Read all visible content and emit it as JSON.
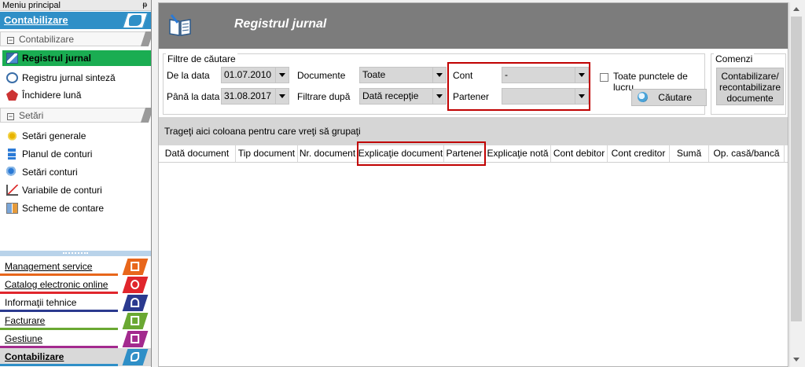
{
  "sidebar": {
    "title": "Meniu principal",
    "pin": "ᵽ",
    "section_title": "Contabilizare",
    "group1": {
      "label": "Contabilizare",
      "toggle": "−"
    },
    "group1_items": [
      {
        "label": "Registrul jurnal",
        "icon": "journal-book-icon"
      },
      {
        "label": "Registru jurnal sinteză",
        "icon": "refresh-icon"
      },
      {
        "label": "Închidere lună",
        "icon": "gem-icon"
      }
    ],
    "group2": {
      "label": "Setări",
      "toggle": "−"
    },
    "group2_items": [
      {
        "label": "Setări generale",
        "icon": "gear-icon"
      },
      {
        "label": "Planul de conturi",
        "icon": "list-icon"
      },
      {
        "label": "Setări conturi",
        "icon": "settings-icon"
      },
      {
        "label": "Variabile de conturi",
        "icon": "chart-icon"
      },
      {
        "label": "Scheme de contare",
        "icon": "scheme-icon"
      }
    ],
    "modules": [
      {
        "label": "Management service",
        "color": "#e8661b"
      },
      {
        "label": "Catalog electronic online",
        "color": "#e0262c"
      },
      {
        "label": "Informaţii tehnice",
        "color": "#2b3a8f"
      },
      {
        "label": "Facturare",
        "color": "#6aa832"
      },
      {
        "label": "Gestiune",
        "color": "#a32a8e"
      },
      {
        "label": "Contabilizare",
        "color": "#2f8fc7"
      }
    ]
  },
  "header": {
    "title": "Registrul jurnal"
  },
  "filters": {
    "legend": "Filtre de căutare",
    "from_label": "De la data",
    "from_value": "01.07.2010",
    "to_label": "Până la data",
    "to_value": "31.08.2017",
    "documents_label": "Documente",
    "documents_value": "Toate",
    "filter_by_label": "Filtrare după",
    "filter_by_value": "Dată recepţie",
    "account_label": "Cont",
    "account_value": "-",
    "partner_label": "Partener",
    "partner_value": "",
    "all_points_label": "Toate punctele de lucru",
    "search_label": "Căutare"
  },
  "commands": {
    "legend": "Comenzi",
    "contab_button": "Contabilizare/ recontabilizare documente"
  },
  "grid": {
    "group_hint": "Trageţi aici coloana pentru care vreţi să grupaţi",
    "columns": [
      "Dată document",
      "Tip document",
      "Nr. document",
      "Explicaţie document",
      "Partener",
      "Explicaţie notă",
      "Cont debitor",
      "Cont creditor",
      "Sumă",
      "Op. casă/bancă"
    ]
  },
  "colors": {
    "accent": "#2f8fc7",
    "active_item": "#1aad52",
    "highlight_box": "#c00000",
    "banner": "#7c7c7c"
  }
}
